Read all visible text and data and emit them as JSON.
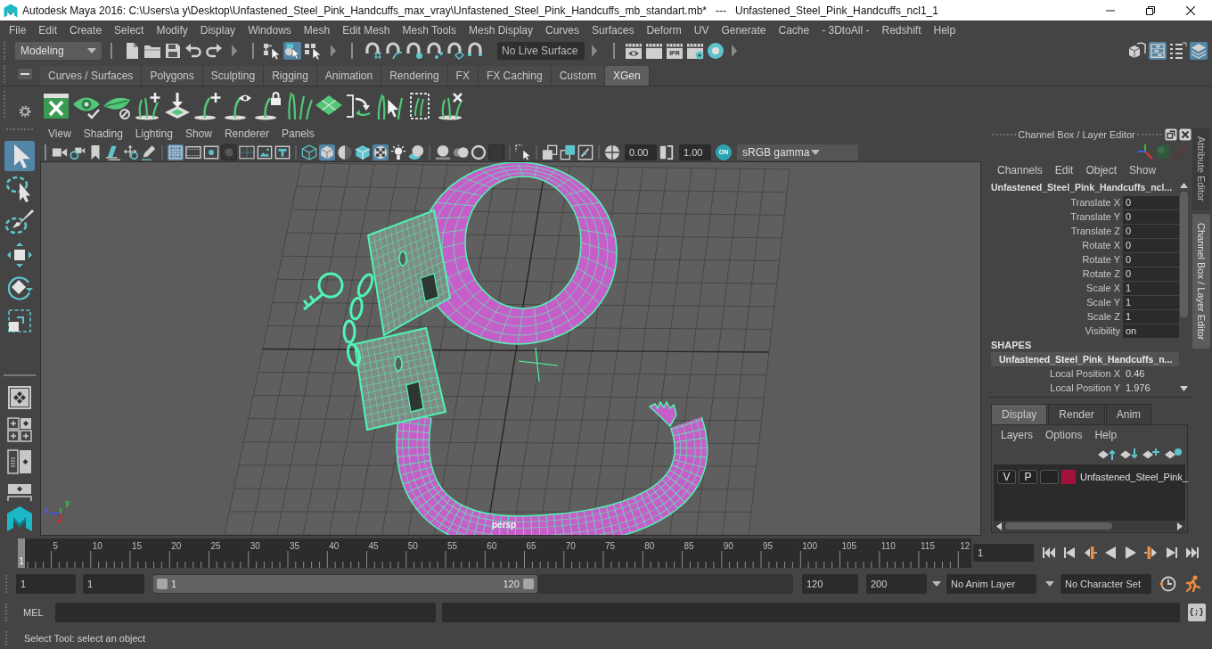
{
  "window": {
    "title": "Autodesk Maya 2016: C:\\Users\\a y\\Desktop\\Unfastened_Steel_Pink_Handcuffs_max_vray\\Unfastened_Steel_Pink_Handcuffs_mb_standart.mb*   ---   Unfastened_Steel_Pink_Handcuffs_ncl1_1"
  },
  "menu": [
    "File",
    "Edit",
    "Create",
    "Select",
    "Modify",
    "Display",
    "Windows",
    "Mesh",
    "Edit Mesh",
    "Mesh Tools",
    "Mesh Display",
    "Curves",
    "Surfaces",
    "Deform",
    "UV",
    "Generate",
    "Cache",
    "- 3DtoAll -",
    "Redshift",
    "Help"
  ],
  "status_line": {
    "menu_set": "Modeling",
    "selection_modes": [
      {
        "on": false
      },
      {
        "on": true
      },
      {
        "on": false
      }
    ],
    "live_surface": "No Live Surface",
    "ipr_label": "IPR",
    "panel_toggles": [
      {
        "on": false
      },
      {
        "on": true
      },
      {
        "on": false
      },
      {
        "on": true
      }
    ]
  },
  "shelf": {
    "tabs": [
      {
        "label": "Curves / Surfaces",
        "selected": false
      },
      {
        "label": "Polygons",
        "selected": false
      },
      {
        "label": "Sculpting",
        "selected": false
      },
      {
        "label": "Rigging",
        "selected": false
      },
      {
        "label": "Animation",
        "selected": false
      },
      {
        "label": "Rendering",
        "selected": false
      },
      {
        "label": "FX",
        "selected": false
      },
      {
        "label": "FX Caching",
        "selected": false
      },
      {
        "label": "Custom",
        "selected": false
      },
      {
        "label": "XGen",
        "selected": true
      }
    ]
  },
  "toolbox": {
    "tools": [
      {
        "selected": true
      },
      {
        "selected": false
      },
      {
        "selected": false
      },
      {
        "selected": false
      },
      {
        "selected": false
      },
      {
        "selected": false
      }
    ]
  },
  "viewport": {
    "menu": [
      "View",
      "Shading",
      "Lighting",
      "Show",
      "Renderer",
      "Panels"
    ],
    "toolbar": [
      {
        "on": false
      },
      {
        "on": false
      },
      {
        "on": false
      },
      {
        "on": false
      },
      {
        "on": false
      },
      {
        "on": false
      },
      {
        "on": true
      },
      {
        "on": false
      },
      {
        "on": false
      },
      {
        "on": false
      },
      {
        "on": false
      },
      {
        "on": false
      },
      {
        "on": false
      },
      {
        "on": false
      },
      {
        "on": true
      },
      {
        "on": false
      },
      {
        "on": false
      },
      {
        "on": true
      },
      {
        "on": false
      },
      {
        "on": false
      },
      {
        "on": false
      },
      {
        "on": false
      },
      {
        "on": false
      },
      {
        "on": false
      },
      {
        "on": false
      },
      {
        "on": false
      },
      {
        "on": false
      },
      {
        "on": false
      },
      {
        "on": false
      },
      {
        "on": false
      }
    ],
    "exposure": "0.00",
    "gamma": "1.00",
    "view_transform_toggle": {
      "label": "ON",
      "on": true
    },
    "view_transform": "sRGB gamma",
    "axis_labels": [
      "z",
      "y"
    ],
    "camera": "persp"
  },
  "channel_box": {
    "title": "Channel Box / Layer Editor",
    "menu": [
      "Channels",
      "Edit",
      "Object",
      "Show"
    ],
    "object": "Unfastened_Steel_Pink_Handcuffs_ncl...",
    "channels": [
      {
        "name": "Translate X",
        "value": "0"
      },
      {
        "name": "Translate Y",
        "value": "0"
      },
      {
        "name": "Translate Z",
        "value": "0"
      },
      {
        "name": "Rotate X",
        "value": "0"
      },
      {
        "name": "Rotate Y",
        "value": "0"
      },
      {
        "name": "Rotate Z",
        "value": "0"
      },
      {
        "name": "Scale X",
        "value": "1"
      },
      {
        "name": "Scale Y",
        "value": "1"
      },
      {
        "name": "Scale Z",
        "value": "1"
      },
      {
        "name": "Visibility",
        "value": "on"
      }
    ],
    "shapes_heading": "SHAPES",
    "shape": "Unfastened_Steel_Pink_Handcuffs_n...",
    "shape_channels": [
      {
        "name": "Local Position X",
        "value": "0.46"
      },
      {
        "name": "Local Position Y",
        "value": "1.976"
      }
    ]
  },
  "layer_editor": {
    "tabs": [
      {
        "label": "Display",
        "selected": true
      },
      {
        "label": "Render",
        "selected": false
      },
      {
        "label": "Anim",
        "selected": false
      }
    ],
    "menu": [
      "Layers",
      "Options",
      "Help"
    ],
    "layers": [
      {
        "visibility": "V",
        "playback": "P",
        "color": "#a3123a",
        "name": "Unfastened_Steel_Pink_"
      }
    ]
  },
  "side_tabs": [
    {
      "label": "Attribute Editor",
      "selected": false
    },
    {
      "label": "Channel Box / Layer Editor",
      "selected": true
    }
  ],
  "timeline": {
    "labels": [
      "5",
      "10",
      "15",
      "20",
      "25",
      "30",
      "35",
      "40",
      "45",
      "50",
      "55",
      "60",
      "65",
      "70",
      "75",
      "80",
      "85",
      "90",
      "95",
      "100",
      "105",
      "110",
      "115",
      "12"
    ],
    "current_frame": "1",
    "level": 0,
    "frame_field": "1"
  },
  "range": {
    "start": "1",
    "playback_start": "1",
    "slider_start": "1",
    "slider_end": "120",
    "level": 0.6,
    "playback_end": "120",
    "end": "200",
    "anim_layer": "No Anim Layer",
    "character_set": "No Character Set"
  },
  "command_line": {
    "language": "MEL",
    "script_button": "{;}"
  },
  "help_line": "Select Tool: select an object"
}
